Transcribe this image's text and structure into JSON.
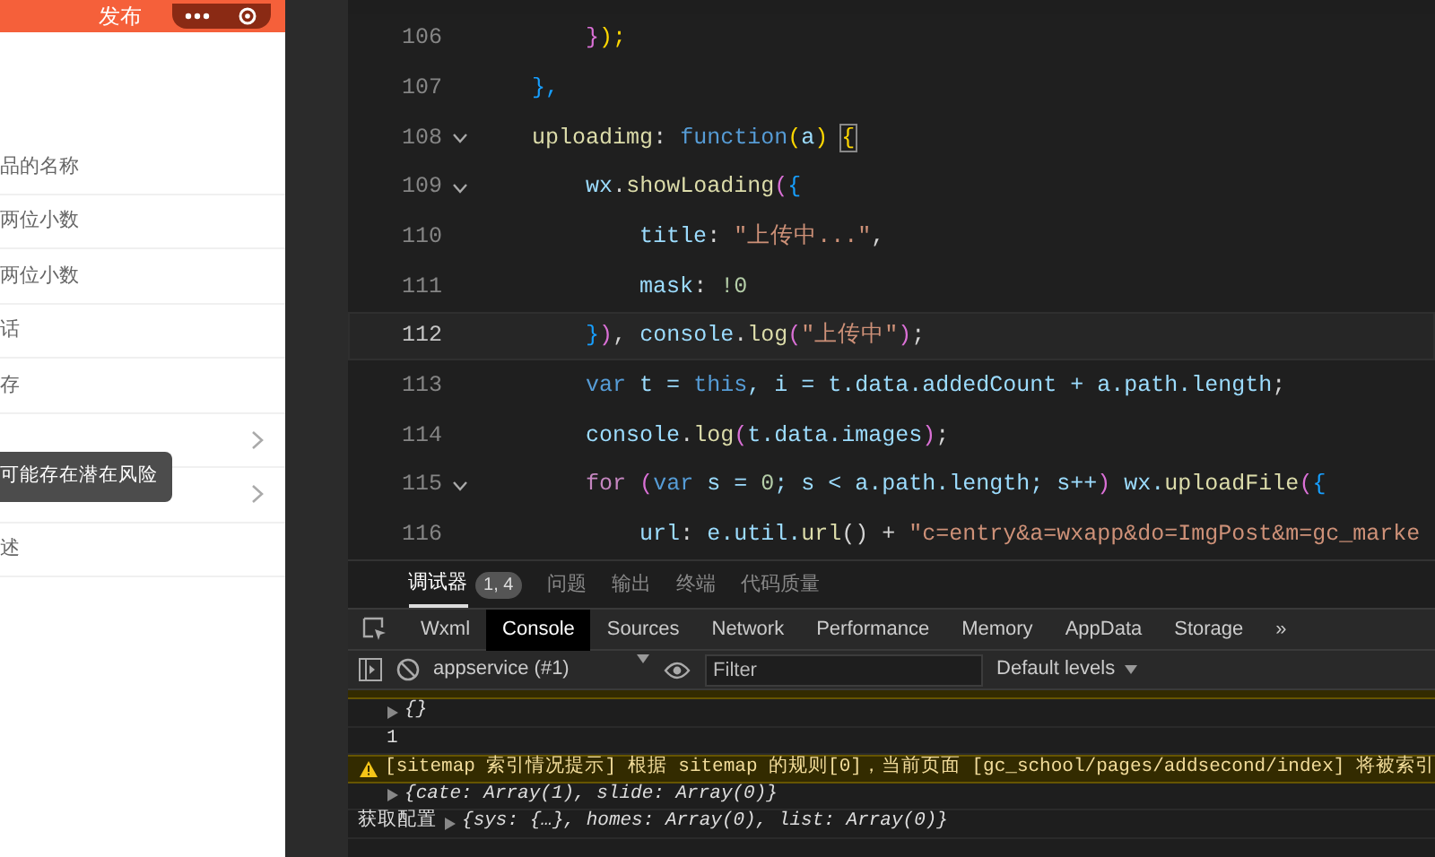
{
  "phone": {
    "header_title": "发布",
    "rows": [
      {
        "label": "品的名称",
        "chevron": false
      },
      {
        "label": "两位小数",
        "chevron": false
      },
      {
        "label": "两位小数",
        "chevron": false
      },
      {
        "label": "话",
        "chevron": false
      },
      {
        "label": "存",
        "chevron": false
      },
      {
        "chevron": true
      },
      {
        "chevron": true
      },
      {
        "label": "述",
        "chevron": false
      }
    ],
    "tooltip": "可能存在潜在风险"
  },
  "editor": {
    "lines": [
      {
        "number": "106",
        "fold": false,
        "current": false,
        "tokens": [
          {
            "text": "        }",
            "kind": "b2"
          },
          {
            "text": ");",
            "kind": "b1"
          }
        ]
      },
      {
        "number": "107",
        "fold": false,
        "current": false,
        "tokens": [
          {
            "text": "    },",
            "kind": "b3"
          }
        ]
      },
      {
        "number": "108",
        "fold": true,
        "current": false,
        "tokens": [
          {
            "text": "    uploadimg",
            "kind": "fn"
          },
          {
            "text": ": ",
            "kind": "pl"
          },
          {
            "text": "function",
            "kind": "kw"
          },
          {
            "text": "(",
            "kind": "b1"
          },
          {
            "text": "a",
            "kind": "pr"
          },
          {
            "text": ") ",
            "kind": "b1"
          },
          {
            "text": "{",
            "kind": "cursor"
          }
        ]
      },
      {
        "number": "109",
        "fold": true,
        "current": false,
        "tokens": [
          {
            "text": "        wx",
            "kind": "pr"
          },
          {
            "text": ".",
            "kind": "pl"
          },
          {
            "text": "showLoading",
            "kind": "fn"
          },
          {
            "text": "(",
            "kind": "b2"
          },
          {
            "text": "{",
            "kind": "b3"
          }
        ]
      },
      {
        "number": "110",
        "fold": false,
        "current": false,
        "tokens": [
          {
            "text": "            title",
            "kind": "pr"
          },
          {
            "text": ": ",
            "kind": "pl"
          },
          {
            "text": "\"上传中...\"",
            "kind": "str"
          },
          {
            "text": ",",
            "kind": "pl"
          }
        ]
      },
      {
        "number": "111",
        "fold": false,
        "current": false,
        "tokens": [
          {
            "text": "            mask",
            "kind": "pr"
          },
          {
            "text": ": ",
            "kind": "pl"
          },
          {
            "text": "!0",
            "kind": "num"
          }
        ]
      },
      {
        "number": "112",
        "fold": false,
        "current": true,
        "tokens": [
          {
            "text": "        }",
            "kind": "b3"
          },
          {
            "text": ")",
            "kind": "b2"
          },
          {
            "text": ", ",
            "kind": "pl"
          },
          {
            "text": "console",
            "kind": "pr"
          },
          {
            "text": ".",
            "kind": "pl"
          },
          {
            "text": "log",
            "kind": "fn"
          },
          {
            "text": "(",
            "kind": "b2"
          },
          {
            "text": "\"上传中\"",
            "kind": "str"
          },
          {
            "text": ")",
            "kind": "b2"
          },
          {
            "text": ";",
            "kind": "pl"
          }
        ]
      },
      {
        "number": "113",
        "fold": false,
        "current": false,
        "tokens": [
          {
            "text": "        var",
            "kind": "kw"
          },
          {
            "text": " t = ",
            "kind": "pr"
          },
          {
            "text": "this",
            "kind": "kw"
          },
          {
            "text": ", i = t.data.addedCount + a.path.length",
            "kind": "pr"
          },
          {
            "text": ";",
            "kind": "pl"
          }
        ]
      },
      {
        "number": "114",
        "fold": false,
        "current": false,
        "tokens": [
          {
            "text": "        console",
            "kind": "pr"
          },
          {
            "text": ".",
            "kind": "pl"
          },
          {
            "text": "log",
            "kind": "fn"
          },
          {
            "text": "(",
            "kind": "b2"
          },
          {
            "text": "t.data.images",
            "kind": "pr"
          },
          {
            "text": ")",
            "kind": "b2"
          },
          {
            "text": ";",
            "kind": "pl"
          }
        ]
      },
      {
        "number": "115",
        "fold": true,
        "current": false,
        "tokens": [
          {
            "text": "        for",
            "kind": "ctl"
          },
          {
            "text": " (",
            "kind": "b2"
          },
          {
            "text": "var",
            "kind": "kw"
          },
          {
            "text": " s = ",
            "kind": "pr"
          },
          {
            "text": "0",
            "kind": "num"
          },
          {
            "text": "; s < a.path.length; s++",
            "kind": "pr"
          },
          {
            "text": ")",
            "kind": "b2"
          },
          {
            "text": " wx.",
            "kind": "pr"
          },
          {
            "text": "uploadFile",
            "kind": "fn"
          },
          {
            "text": "(",
            "kind": "b2"
          },
          {
            "text": "{",
            "kind": "b3"
          }
        ]
      },
      {
        "number": "116",
        "fold": false,
        "current": false,
        "tokens": [
          {
            "text": "            url",
            "kind": "pr"
          },
          {
            "text": ": ",
            "kind": "pl"
          },
          {
            "text": "e.util.",
            "kind": "pr"
          },
          {
            "text": "url",
            "kind": "fn"
          },
          {
            "text": "() + ",
            "kind": "pl"
          },
          {
            "text": "\"c=entry&a=wxapp&do=ImgPost&m=gc_marke",
            "kind": "str"
          }
        ]
      }
    ]
  },
  "devtools": {
    "panel_tabs": [
      {
        "label": "调试器",
        "selected": true,
        "badge": "1, 4"
      },
      {
        "label": "问题",
        "selected": false
      },
      {
        "label": "输出",
        "selected": false
      },
      {
        "label": "终端",
        "selected": false
      },
      {
        "label": "代码质量",
        "selected": false
      }
    ],
    "tool_tabs": [
      {
        "label": "Wxml",
        "selected": false
      },
      {
        "label": "Console",
        "selected": true
      },
      {
        "label": "Sources",
        "selected": false
      },
      {
        "label": "Network",
        "selected": false
      },
      {
        "label": "Performance",
        "selected": false
      },
      {
        "label": "Memory",
        "selected": false
      },
      {
        "label": "AppData",
        "selected": false
      },
      {
        "label": "Storage",
        "selected": false
      }
    ],
    "more": "»",
    "context": "appservice (#1)",
    "filter_placeholder": "Filter",
    "levels": "Default levels",
    "console": [
      {
        "kind": "object",
        "text": "{}"
      },
      {
        "kind": "value",
        "text": "1"
      },
      {
        "kind": "warning",
        "text": "[sitemap 索引情况提示] 根据 sitemap 的规则[0]，当前页面 [gc_school/pages/addsecond/index] 将被索引"
      },
      {
        "kind": "object",
        "text": "{cate: Array(1), slide: Array(0)}"
      },
      {
        "kind": "object",
        "prefix": "获取配置",
        "text": "{sys: {…}, homes: Array(0), list: Array(0)}"
      }
    ]
  }
}
